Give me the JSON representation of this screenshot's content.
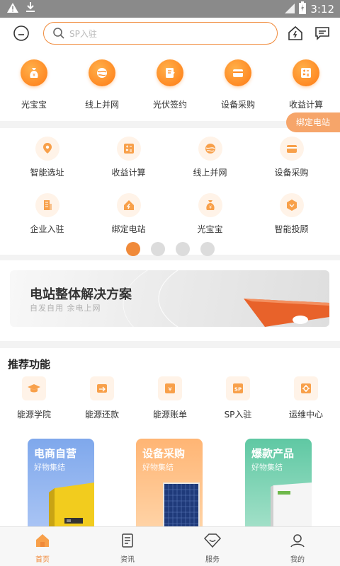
{
  "status_bar": {
    "time": "3:12"
  },
  "header": {
    "search_placeholder": "SP入驻"
  },
  "quick_row": [
    {
      "label": "光宝宝",
      "icon": "money-bag-icon"
    },
    {
      "label": "线上并网",
      "icon": "grid-connect-icon"
    },
    {
      "label": "光伏签约",
      "icon": "contract-icon"
    },
    {
      "label": "设备采购",
      "icon": "purchase-icon"
    },
    {
      "label": "收益计算",
      "icon": "calculator-icon"
    }
  ],
  "bind_station_tag": "绑定电站",
  "grid_menu": [
    {
      "label": "智能选址",
      "icon": "location-icon"
    },
    {
      "label": "收益计算",
      "icon": "calculator-icon"
    },
    {
      "label": "线上并网",
      "icon": "grid-connect-icon"
    },
    {
      "label": "设备采购",
      "icon": "purchase-icon"
    },
    {
      "label": "企业入驻",
      "icon": "building-icon"
    },
    {
      "label": "绑定电站",
      "icon": "home-bolt-icon"
    },
    {
      "label": "光宝宝",
      "icon": "money-bag-icon"
    },
    {
      "label": "智能投顾",
      "icon": "box-icon"
    }
  ],
  "pager": {
    "pages": 4,
    "current": 1
  },
  "banner": {
    "title": "电站整体解决方案",
    "subtitle": "自发自用  余电上网"
  },
  "recommended": {
    "title": "推荐功能",
    "items": [
      {
        "label": "能源学院",
        "icon": "graduation-cap-icon"
      },
      {
        "label": "能源还款",
        "icon": "repay-icon"
      },
      {
        "label": "能源账单",
        "icon": "bill-icon"
      },
      {
        "label": "SP入驻",
        "icon": "sp-icon"
      },
      {
        "label": "运维中心",
        "icon": "maintenance-icon"
      }
    ],
    "cards": [
      {
        "title": "电商自营",
        "subtitle": "好物集结"
      },
      {
        "title": "设备采购",
        "subtitle": "好物集结"
      },
      {
        "title": "爆款产品",
        "subtitle": "好物集结"
      }
    ]
  },
  "bottom_nav": [
    {
      "label": "首页",
      "icon": "home-icon",
      "active": true
    },
    {
      "label": "资讯",
      "icon": "news-icon",
      "active": false
    },
    {
      "label": "服务",
      "icon": "service-icon",
      "active": false
    },
    {
      "label": "我的",
      "icon": "user-icon",
      "active": false
    }
  ],
  "colors": {
    "accent": "#f08a3a",
    "accent_light": "#fff3e8",
    "tag_bg": "#f6a56a"
  }
}
